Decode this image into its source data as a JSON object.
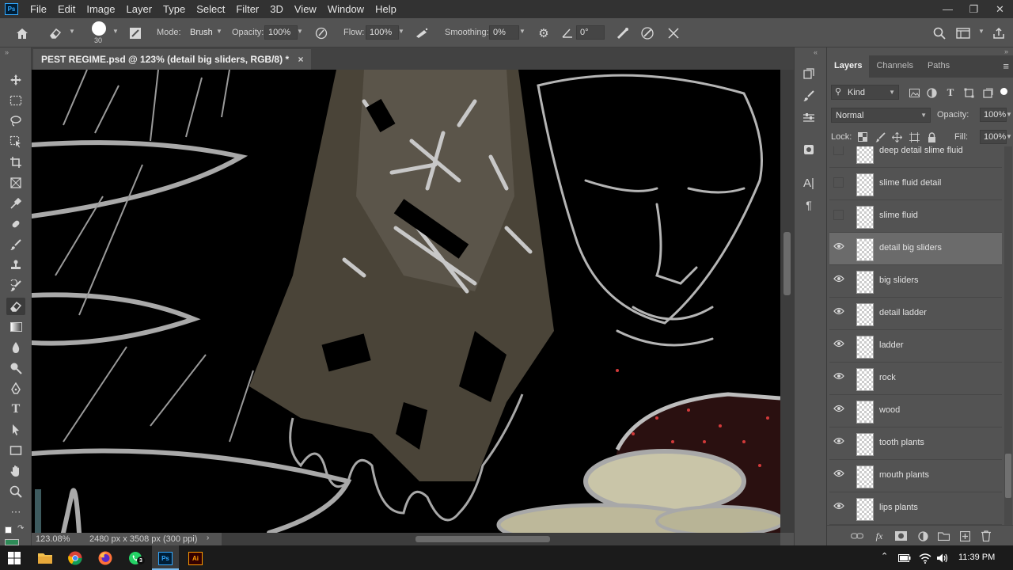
{
  "app": {
    "logo": "Ps"
  },
  "menu": [
    "File",
    "Edit",
    "Image",
    "Layer",
    "Type",
    "Select",
    "Filter",
    "3D",
    "View",
    "Window",
    "Help"
  ],
  "options": {
    "brush_size": "30",
    "mode_label": "Mode:",
    "mode_value": "Brush",
    "opacity_label": "Opacity:",
    "opacity_value": "100%",
    "flow_label": "Flow:",
    "flow_value": "100%",
    "smoothing_label": "Smoothing:",
    "smoothing_value": "0%",
    "angle_value": "0°"
  },
  "document": {
    "tab_title": "PEST REGIME.psd @ 123% (detail big sliders, RGB/8) *",
    "close_glyph": "×"
  },
  "status": {
    "zoom": "123.08%",
    "dimensions": "2480 px x 3508 px (300 ppi)"
  },
  "layers_panel": {
    "tabs": [
      "Layers",
      "Channels",
      "Paths"
    ],
    "filter_label": "Kind",
    "blend_mode": "Normal",
    "opacity_label": "Opacity:",
    "opacity_value": "100%",
    "lock_label": "Lock:",
    "fill_label": "Fill:",
    "fill_value": "100%",
    "layers": [
      {
        "name": "deep detail slime fluid",
        "visible": false,
        "selected": false
      },
      {
        "name": "slime fluid detail",
        "visible": false,
        "selected": false
      },
      {
        "name": "slime fluid",
        "visible": false,
        "selected": false
      },
      {
        "name": "detail big sliders",
        "visible": true,
        "selected": true
      },
      {
        "name": "big sliders",
        "visible": true,
        "selected": false
      },
      {
        "name": "detail ladder",
        "visible": true,
        "selected": false
      },
      {
        "name": "ladder",
        "visible": true,
        "selected": false
      },
      {
        "name": "rock",
        "visible": true,
        "selected": false
      },
      {
        "name": "wood",
        "visible": true,
        "selected": false
      },
      {
        "name": "tooth plants",
        "visible": true,
        "selected": false
      },
      {
        "name": "mouth plants",
        "visible": true,
        "selected": false
      },
      {
        "name": "lips plants",
        "visible": true,
        "selected": false
      }
    ]
  },
  "taskbar": {
    "time": "11:39 PM",
    "apps": [
      "windows-start",
      "file-explorer",
      "chrome",
      "firefox",
      "whatsapp",
      "photoshop",
      "illustrator"
    ],
    "whatsapp_badge": "3",
    "ps_label": "Ps",
    "ai_label": "Ai"
  },
  "colors": {
    "accent": "#31a8ff",
    "illustrator": "#ff9a00",
    "panel_bg": "#535353",
    "selected_layer": "#6b6b6b"
  }
}
